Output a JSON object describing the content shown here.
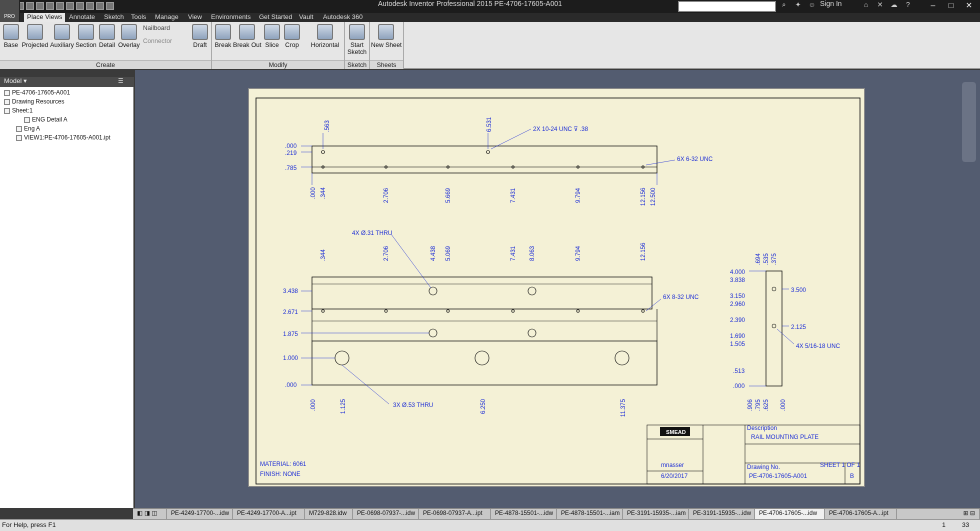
{
  "app": {
    "title": "Autodesk Inventor Professional 2015 PE-4706-17605-A001",
    "search_placeholder": "",
    "sign_in": "Sign In",
    "pro_badge": "PRO"
  },
  "ribbon_tabs": [
    "Place Views",
    "Annotate",
    "Sketch",
    "Tools",
    "Manage",
    "View",
    "Environments",
    "Get Started",
    "Vault",
    "Autodesk 360"
  ],
  "ribbon": {
    "create": {
      "label": "Create",
      "buttons": [
        "Base",
        "Projected",
        "Auxiliary",
        "Section",
        "Detail",
        "Overlay"
      ],
      "nailboard": "Nailboard",
      "connector": "Connector"
    },
    "draft": "Draft",
    "modify": {
      "label": "Modify",
      "buttons": [
        "Break",
        "Break Out",
        "Slice",
        "Crop",
        "Horizontal"
      ]
    },
    "sketch": {
      "label": "Sketch",
      "button_line1": "Start",
      "button_line2": "Sketch"
    },
    "sheets": {
      "label": "Sheets",
      "button": "New Sheet"
    }
  },
  "browser": {
    "title": "Model ▾",
    "items": [
      "PE-4706-17605-A001",
      "Drawing Resources",
      "Sheet:1",
      "ENG Detail A",
      "Eng A",
      "VIEW1:PE-4706-17605-A001.ipt"
    ]
  },
  "drawing": {
    "top_view_dims": [
      ".000",
      ".219",
      ".785",
      ".563",
      "6.531",
      "2X 10-24 UNC ⊽ .38",
      "6X 6-32 UNC",
      ".000",
      ".344",
      "2.706",
      "5.669",
      "7.431",
      "9.794",
      "12.156",
      "12.500"
    ],
    "front_view_dims": [
      "4X Ø.31 THRU",
      ".344",
      "2.706",
      "4.438",
      "5.069",
      "7.431",
      "8.063",
      "9.794",
      "12.156",
      "3.438",
      "2.671",
      "1.875",
      "1.000",
      ".000",
      "6X 8-32 UNC",
      ".000",
      "1.125",
      "6.250",
      "11.375",
      "3X Ø.53 THRU"
    ],
    "side_view_dims": [
      "4.000",
      "3.838",
      "3.150",
      "2.960",
      "2.390",
      "1.690",
      "1.505",
      ".513",
      ".000",
      "3.500",
      "2.125",
      "4X 5/16-18 UNC",
      ".694",
      ".535",
      ".375",
      ".906",
      ".795",
      ".625",
      ".000"
    ],
    "material": "MATERIAL: 6061",
    "finish": "FINISH: NONE",
    "title_block": {
      "company": "SMEAD",
      "title": "RAIL MOUNTING PLATE",
      "description_label": "Description",
      "drawing_no_label": "Drawing No.",
      "drawing_number": "PE-4706-17605-A001",
      "date": "6/20/2017",
      "size": "B",
      "sheet": "SHEET 1 OF 1",
      "name": "mnasser"
    }
  },
  "doc_tabs": [
    "PE-4249-17700-...idw",
    "PE-4249-17700-A...ipt",
    "M729-828.idw",
    "PE-0698-07937-...idw",
    "PE-0698-07937-A...ipt",
    "PE-4878-15501-...idw",
    "PE-4878-15501-...iam",
    "PE-3191-15935-...iam",
    "PE-3191-15935-...idw",
    "PE-4706-17605-...idw",
    "PE-4706-17605-A...ipt"
  ],
  "status": {
    "help": "For Help, press F1",
    "num1": "1",
    "num2": "33"
  }
}
